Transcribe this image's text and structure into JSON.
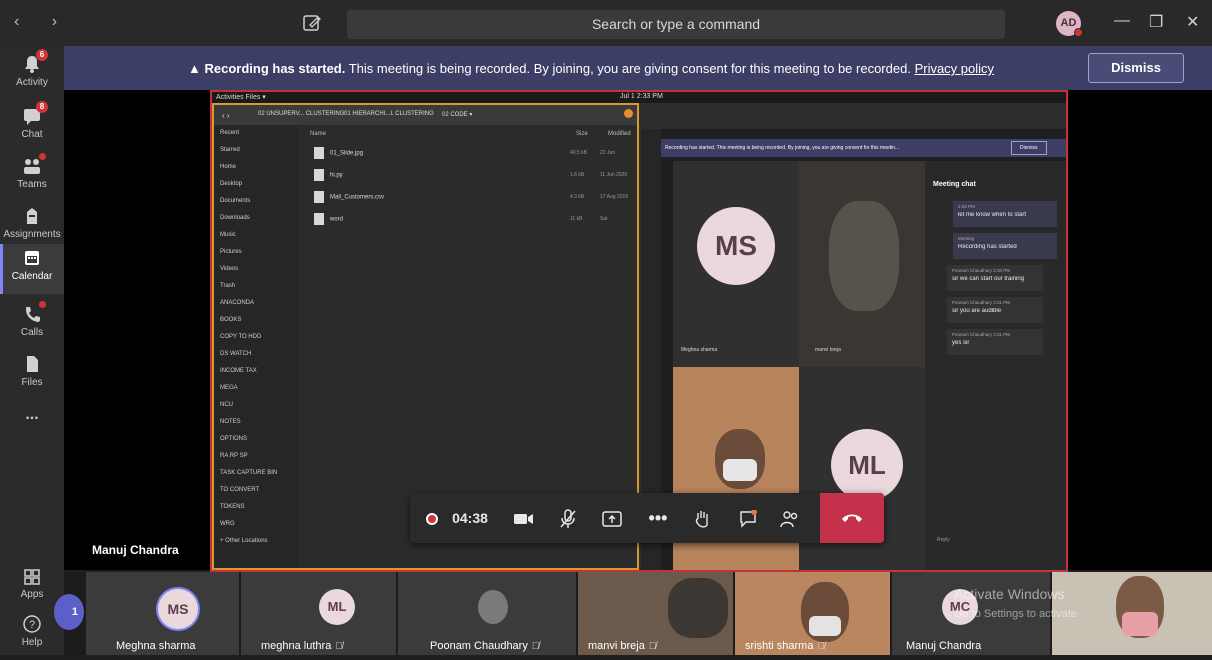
{
  "titlebar": {
    "search_placeholder": "Search or type a command",
    "user_initials": "AD",
    "nav_arrows": "‹ ›",
    "minimize": "—",
    "restore": "❐",
    "close": "✕"
  },
  "rail": {
    "items": [
      {
        "label": "Activity",
        "badge": "6",
        "icon": "bell-icon"
      },
      {
        "label": "Chat",
        "badge": "8",
        "icon": "chat-icon"
      },
      {
        "label": "Teams",
        "badge": "",
        "icon": "teams-icon"
      },
      {
        "label": "Assignments",
        "badge": "",
        "icon": "assignments-icon"
      },
      {
        "label": "Calendar",
        "badge": "",
        "icon": "calendar-icon"
      },
      {
        "label": "Calls",
        "badge": "",
        "icon": "phone-icon"
      },
      {
        "label": "Files",
        "badge": "",
        "icon": "file-icon"
      },
      {
        "label": "...",
        "badge": "",
        "icon": "more-icon"
      }
    ],
    "apps_label": "Apps",
    "help_label": "Help"
  },
  "banner": {
    "bold": "Recording has started.",
    "text": " This meeting is being recorded. By joining, you are giving consent for this meeting to be recorded. ",
    "link": "Privacy policy",
    "dismiss": "Dismiss"
  },
  "shared_screen": {
    "topbar_left": "Activities   Files ▾",
    "topbar_center": "Jul 1  2:33 PM",
    "breadcrumb": [
      "02 UNSUPERV... CLUSTERING",
      "01 HIERARCHI...L CLUSTERING",
      "02 CODE ▾"
    ],
    "sidebar": [
      "Recent",
      "Starred",
      "Home",
      "Desktop",
      "Documents",
      "Downloads",
      "Music",
      "Pictures",
      "Videos",
      "Trash",
      "ANACONDA",
      "BOOKS",
      "COPY TO HDD",
      "DS WATCH",
      "INCOME TAX",
      "MEGA",
      "NCU",
      "NOTES",
      "OPTIONS",
      "RA RP SP",
      "TASK CAPTURE BIN",
      "TO CONVERT",
      "TOKENS",
      "WRG",
      "+ Other Locations"
    ],
    "columns": {
      "name": "Name",
      "size": "Size",
      "modified": "Modified"
    },
    "files": [
      {
        "name": "01_Slide.jpg",
        "size": "40.5 kB",
        "modified": "22 Jun"
      },
      {
        "name": "hi.py",
        "size": "1.6 kB",
        "modified": "11 Jun 2020"
      },
      {
        "name": "Mall_Customers.csv",
        "size": "4.3 kB",
        "modified": "17 Aug 2019"
      },
      {
        "name": "word",
        "size": "11 kB",
        "modified": "Sat"
      }
    ],
    "inner_banner": "Recording has started. This meeting is being recorded. By joining, you are giving consent for this meetin...",
    "inner_dismiss": "Dismiss",
    "meeting_chat_title": "Meeting chat",
    "chat": [
      {
        "meta": "2:29 PM",
        "text": "let me know when to start"
      },
      {
        "meta": "Meeting",
        "text": "Recording has started"
      },
      {
        "meta": "Poonam Chaudhary  2:30 PM",
        "text": "sir we can start our training"
      },
      {
        "meta": "Poonam Chaudhary  2:31 PM",
        "text": "sir you are audible"
      },
      {
        "meta": "Poonam Chaudhary  2:31 PM",
        "text": "yes sir"
      }
    ],
    "tile_ms": "MS",
    "tile_ml": "ML",
    "tile_ms_name": "Meghna sharma",
    "tile_manvi_name": "manvi breja",
    "reply": "Reply"
  },
  "controls": {
    "timer": "04:38"
  },
  "presenter_name": "Manuj Chandra",
  "gallery": [
    {
      "name": "Meghna sharma",
      "initials": "MS",
      "muted": false
    },
    {
      "name": "meghna luthra",
      "initials": "ML",
      "muted": true
    },
    {
      "name": "Poonam Chaudhary",
      "initials": "",
      "muted": true
    },
    {
      "name": "manvi breja",
      "initials": "",
      "muted": true
    },
    {
      "name": "srishti sharma",
      "initials": "",
      "muted": true
    },
    {
      "name": "Manuj Chandra",
      "initials": "MC",
      "muted": false
    }
  ],
  "overflow_count": "1",
  "watermark": {
    "line1": "Activate Windows",
    "line2": "Go to Settings to activate"
  }
}
